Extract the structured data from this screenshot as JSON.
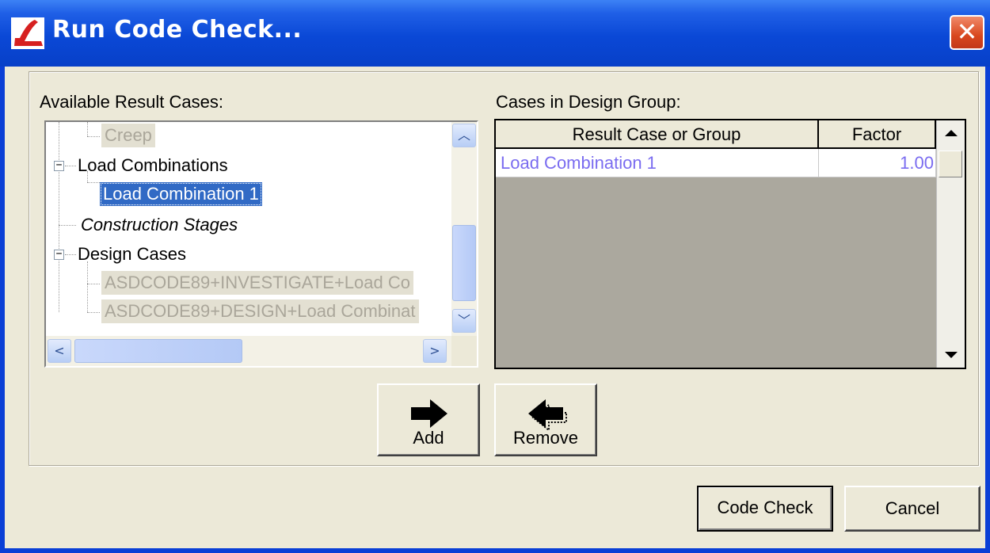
{
  "window": {
    "title": "Run Code Check..."
  },
  "left": {
    "label": "Available Result Cases:",
    "items": {
      "creep": "Creep",
      "load_combinations": "Load Combinations",
      "load_combination_1": "Load Combination 1",
      "construction_stages": "Construction Stages",
      "design_cases": "Design Cases",
      "asd_investigate": "ASDCODE89+INVESTIGATE+Load Co",
      "asd_design": "ASDCODE89+DESIGN+Load Combinat"
    }
  },
  "right": {
    "label": "Cases in Design Group:",
    "columns": [
      "Result Case or Group",
      "Factor"
    ],
    "rows": [
      {
        "case": "Load Combination 1",
        "factor": "1.00"
      }
    ]
  },
  "buttons": {
    "add": "Add",
    "remove": "Remove",
    "code_check": "Code Check",
    "cancel": "Cancel"
  },
  "icons": {
    "app": "app-logo-icon",
    "close": "close-icon",
    "add": "right-arrow-icon",
    "remove": "left-arrow-icon"
  },
  "colors": {
    "titlebar": "#0a48d6",
    "selection": "#316ac5",
    "grid_text": "#7a6cf0",
    "dialog_bg": "#ece9d8"
  }
}
